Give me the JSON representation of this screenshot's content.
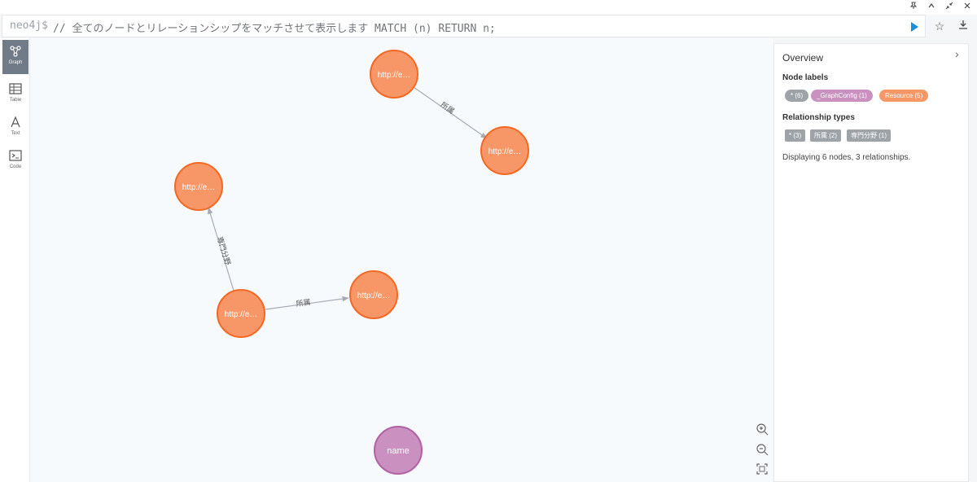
{
  "editor": {
    "prompt": "neo4j$",
    "query": "// 全てのノードとリレーションシップをマッチさせて表示します MATCH (n) RETURN n;"
  },
  "window_controls": [
    "pin-icon",
    "chevron-up-icon",
    "collapse-icon",
    "close-icon"
  ],
  "toolbar_icons": [
    "play-icon",
    "star-icon",
    "download-icon"
  ],
  "sidebar": {
    "items": [
      {
        "label": "Graph",
        "icon": "graph-icon",
        "active": true
      },
      {
        "label": "Table",
        "icon": "table-icon",
        "active": false
      },
      {
        "label": "Text",
        "icon": "text-icon",
        "active": false
      },
      {
        "label": "Code",
        "icon": "code-icon",
        "active": false
      }
    ]
  },
  "graph": {
    "nodes": [
      {
        "id": "n1",
        "caption": "http://e…",
        "label": "Resource"
      },
      {
        "id": "n2",
        "caption": "http://e…",
        "label": "Resource"
      },
      {
        "id": "n3",
        "caption": "http://e…",
        "label": "Resource"
      },
      {
        "id": "n4",
        "caption": "http://e…",
        "label": "Resource"
      },
      {
        "id": "n5",
        "caption": "http://e…",
        "label": "Resource"
      },
      {
        "id": "n6",
        "caption": "name",
        "label": "_GraphConfig"
      }
    ],
    "relationships": [
      {
        "from": "n1",
        "to": "n2",
        "type": "所属"
      },
      {
        "from": "n5",
        "to": "n3",
        "type": "専門分野"
      },
      {
        "from": "n5",
        "to": "n4",
        "type": "所属"
      }
    ],
    "colors": {
      "resource_fill": "#f79767",
      "resource_stroke": "#f36924",
      "config_fill": "#c990c0",
      "config_stroke": "#b261a5",
      "edge": "#a5abb6"
    }
  },
  "zoom_controls": [
    "zoom-in-icon",
    "zoom-out-icon",
    "fit-icon"
  ],
  "overview": {
    "title": "Overview",
    "node_labels_heading": "Node labels",
    "node_labels": [
      {
        "text": "* (6)",
        "color": "#9ea3a8"
      },
      {
        "text": "_GraphConfig (1)",
        "color": "#c990c0"
      },
      {
        "text": "Resource (5)",
        "color": "#f79767"
      }
    ],
    "relationship_types_heading": "Relationship types",
    "relationship_types": [
      {
        "text": "* (3)"
      },
      {
        "text": "所属 (2)"
      },
      {
        "text": "専門分野 (1)"
      }
    ],
    "summary": "Displaying 6 nodes, 3 relationships."
  }
}
